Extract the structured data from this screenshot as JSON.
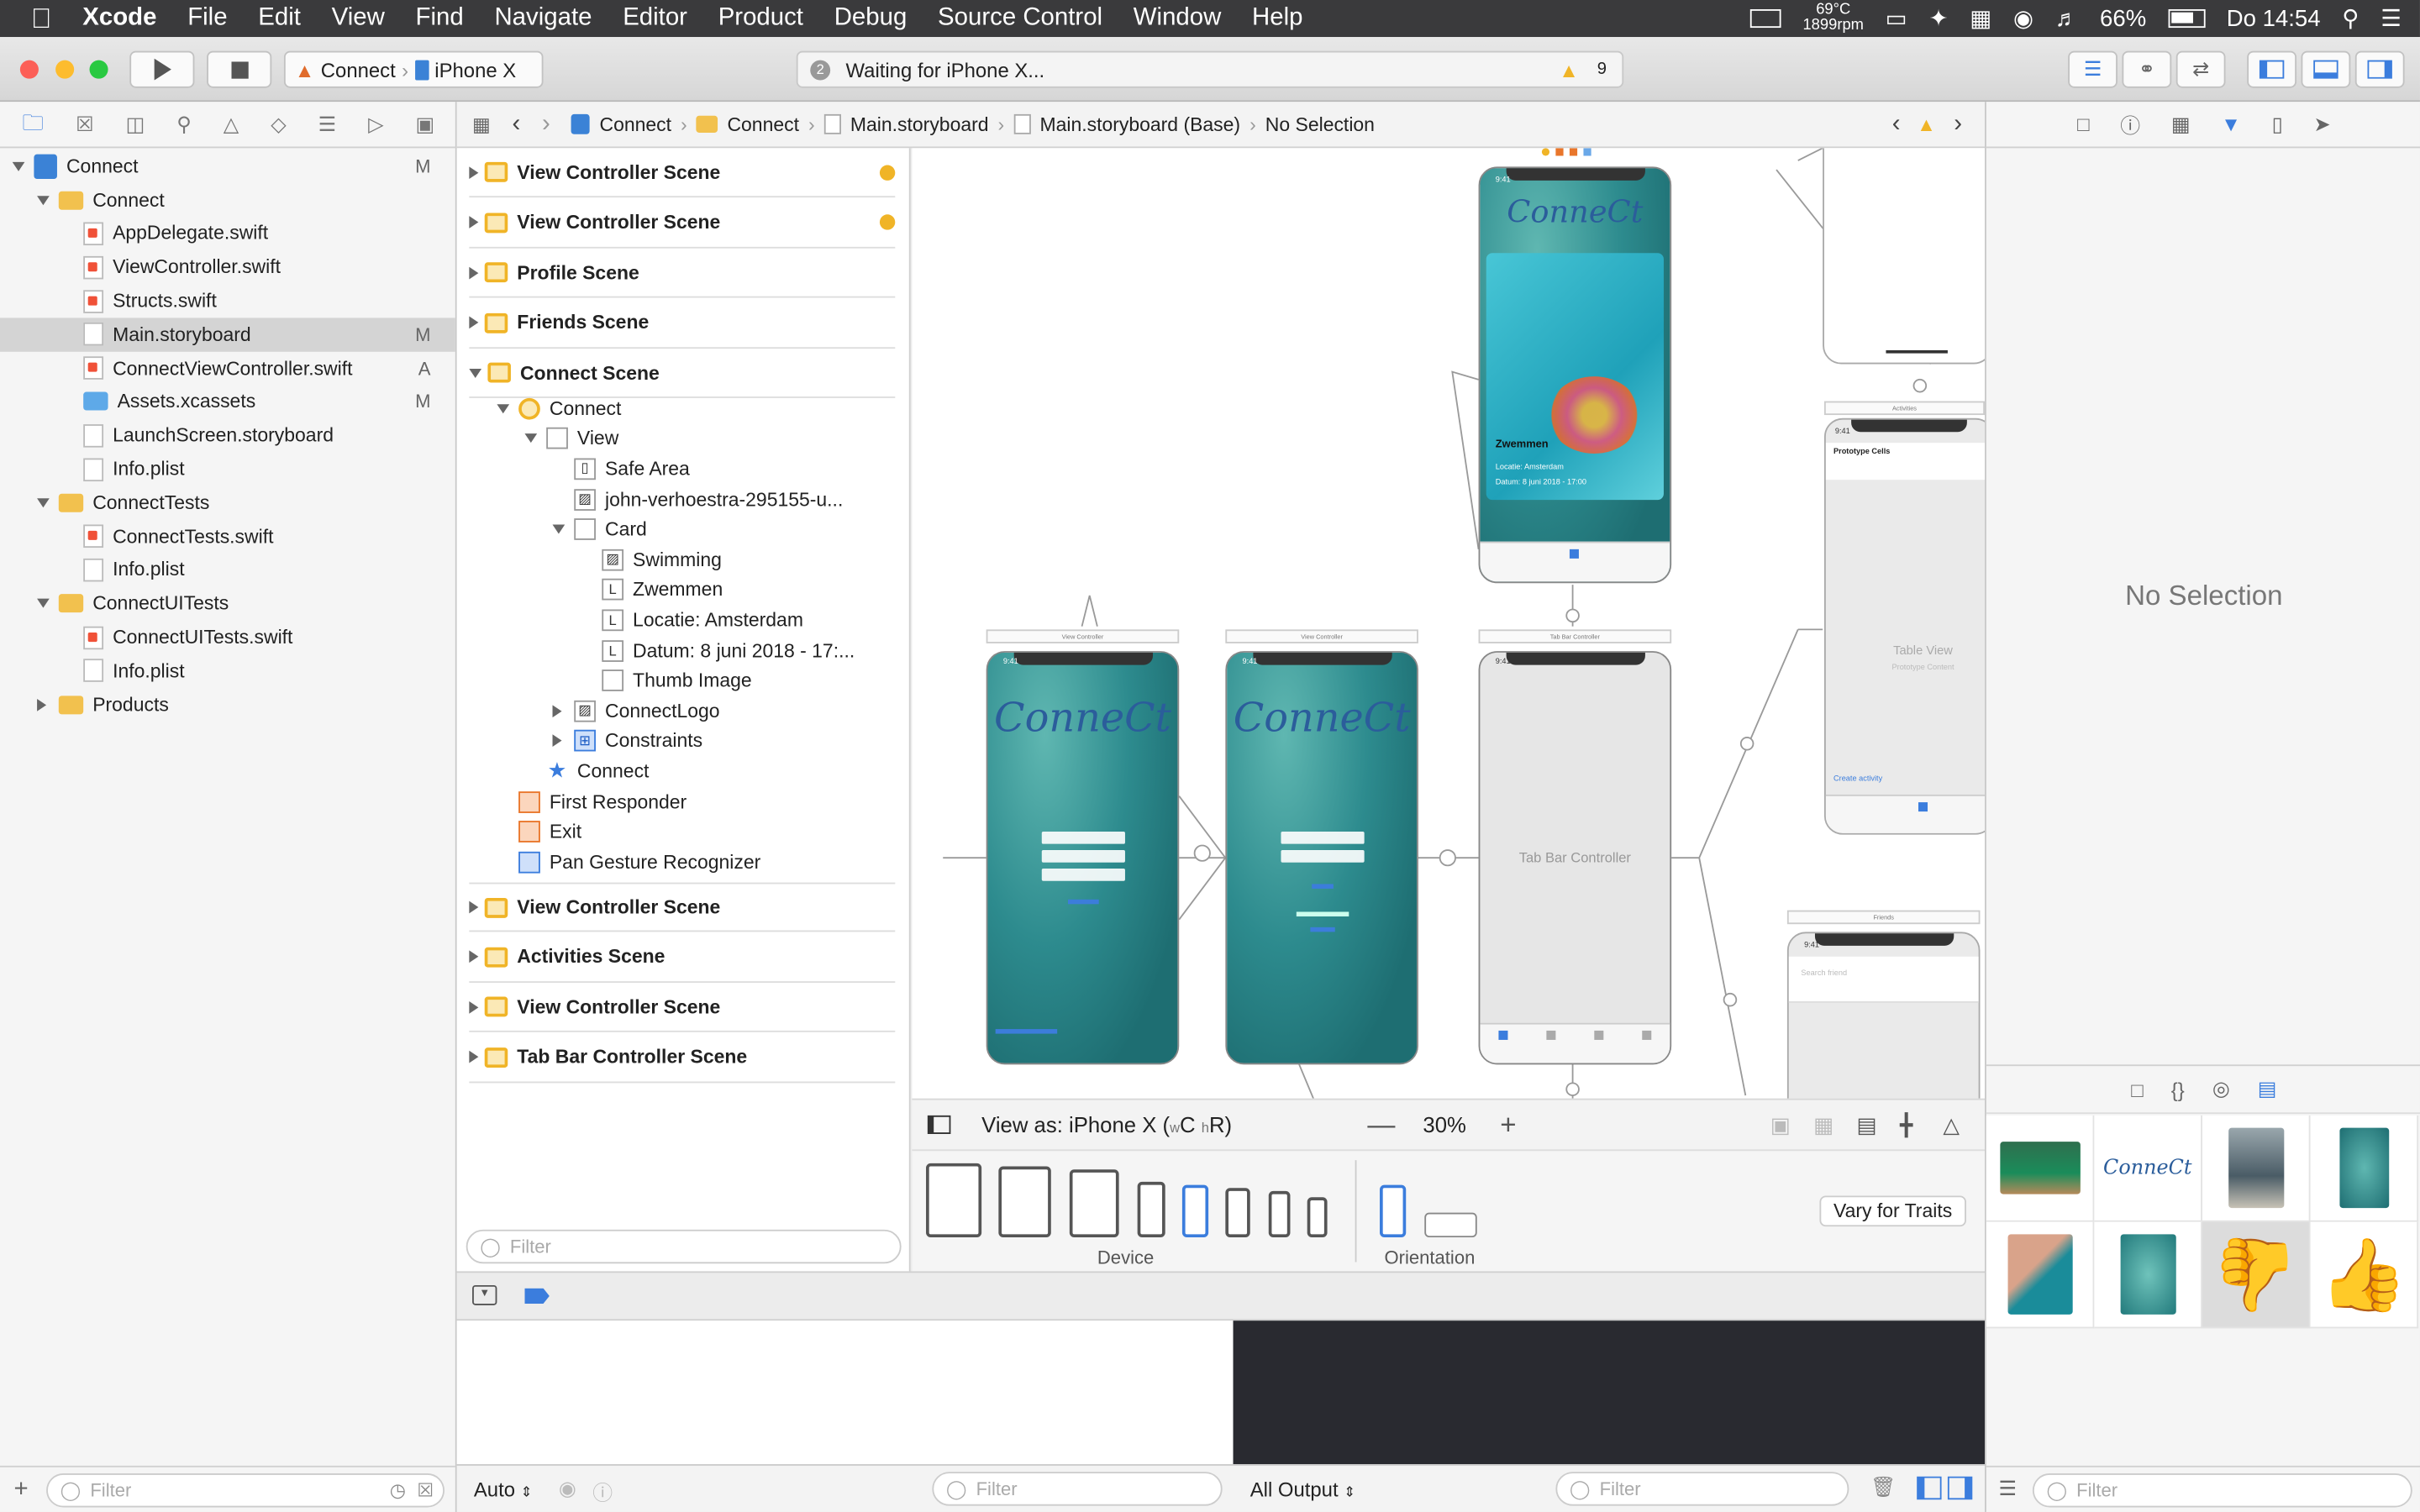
{
  "menubar": {
    "items": [
      "Xcode",
      "File",
      "Edit",
      "View",
      "Find",
      "Navigate",
      "Editor",
      "Product",
      "Debug",
      "Source Control",
      "Window",
      "Help"
    ],
    "temp": "69°C",
    "rpm": "1899rpm",
    "battery": "66%",
    "clock": "Do 14:54"
  },
  "toolbar": {
    "scheme": "Connect",
    "device": "iPhone X",
    "status": "Waiting for iPhone X...",
    "status_badge": "2",
    "warnings": "9"
  },
  "navigator": {
    "rows": [
      {
        "label": "Connect",
        "badge": "M",
        "kind": "project"
      },
      {
        "label": "Connect",
        "badge": "",
        "kind": "folder"
      },
      {
        "label": "AppDelegate.swift",
        "badge": "",
        "kind": "swift"
      },
      {
        "label": "ViewController.swift",
        "badge": "",
        "kind": "swift"
      },
      {
        "label": "Structs.swift",
        "badge": "",
        "kind": "swift"
      },
      {
        "label": "Main.storyboard",
        "badge": "M",
        "kind": "storyboard"
      },
      {
        "label": "ConnectViewController.swift",
        "badge": "A",
        "kind": "swift"
      },
      {
        "label": "Assets.xcassets",
        "badge": "M",
        "kind": "assets"
      },
      {
        "label": "LaunchScreen.storyboard",
        "badge": "",
        "kind": "storyboard"
      },
      {
        "label": "Info.plist",
        "badge": "",
        "kind": "plist"
      },
      {
        "label": "ConnectTests",
        "badge": "",
        "kind": "folder"
      },
      {
        "label": "ConnectTests.swift",
        "badge": "",
        "kind": "swift"
      },
      {
        "label": "Info.plist",
        "badge": "",
        "kind": "plist"
      },
      {
        "label": "ConnectUITests",
        "badge": "",
        "kind": "folder"
      },
      {
        "label": "ConnectUITests.swift",
        "badge": "",
        "kind": "swift"
      },
      {
        "label": "Info.plist",
        "badge": "",
        "kind": "plist"
      },
      {
        "label": "Products",
        "badge": "",
        "kind": "folder"
      }
    ],
    "filter_placeholder": "Filter"
  },
  "jumpbar": {
    "crumbs": [
      "Connect",
      "Connect",
      "Main.storyboard",
      "Main.storyboard (Base)",
      "No Selection"
    ]
  },
  "outline": {
    "scenes_top": [
      "View Controller Scene",
      "View Controller Scene",
      "Profile Scene",
      "Friends Scene",
      "Connect Scene"
    ],
    "items": [
      "Connect",
      "View",
      "Safe Area",
      "john-verhoestra-295155-u...",
      "Card",
      "Swimming",
      "Zwemmen",
      "Locatie: Amsterdam",
      "Datum: 8 juni 2018 - 17:...",
      "Thumb Image",
      "ConnectLogo",
      "Constraints",
      "Connect",
      "First Responder",
      "Exit",
      "Pan Gesture Recognizer"
    ],
    "scenes_bottom": [
      "View Controller Scene",
      "Activities Scene",
      "View Controller Scene",
      "Tab Bar Controller Scene"
    ],
    "filter_placeholder": "Filter"
  },
  "canvas": {
    "logo": "ConneCt",
    "card_title": "Zwemmen",
    "card_location": "Locatie: Amsterdam",
    "card_date": "Datum: 8 juni 2018 - 17:00",
    "tab_bar_controller": "Tab Bar Controller",
    "table_view": "Table View",
    "prototype_content": "Prototype Content",
    "prototype_cells": "Prototype Cells",
    "create_activity": "Create activity",
    "view_controller_label": "View Controller",
    "tab_bar_label": "Tab Bar Controller",
    "activities_label": "Activities",
    "friends_label": "Friends",
    "search_friend": "Search friend",
    "time": "9:41"
  },
  "canvasbar": {
    "view_as": "View as: iPhone X (",
    "wc": "w",
    "c": "C",
    "hr": "h",
    "r": "R)",
    "zoom": "30%"
  },
  "devicebar": {
    "device_label": "Device",
    "orientation_label": "Orientation",
    "vary_button": "Vary for Traits"
  },
  "debug": {
    "auto": "Auto",
    "all_output": "All Output",
    "filter_placeholder": "Filter"
  },
  "inspector": {
    "no_selection": "No Selection",
    "filter_placeholder": "Filter"
  }
}
